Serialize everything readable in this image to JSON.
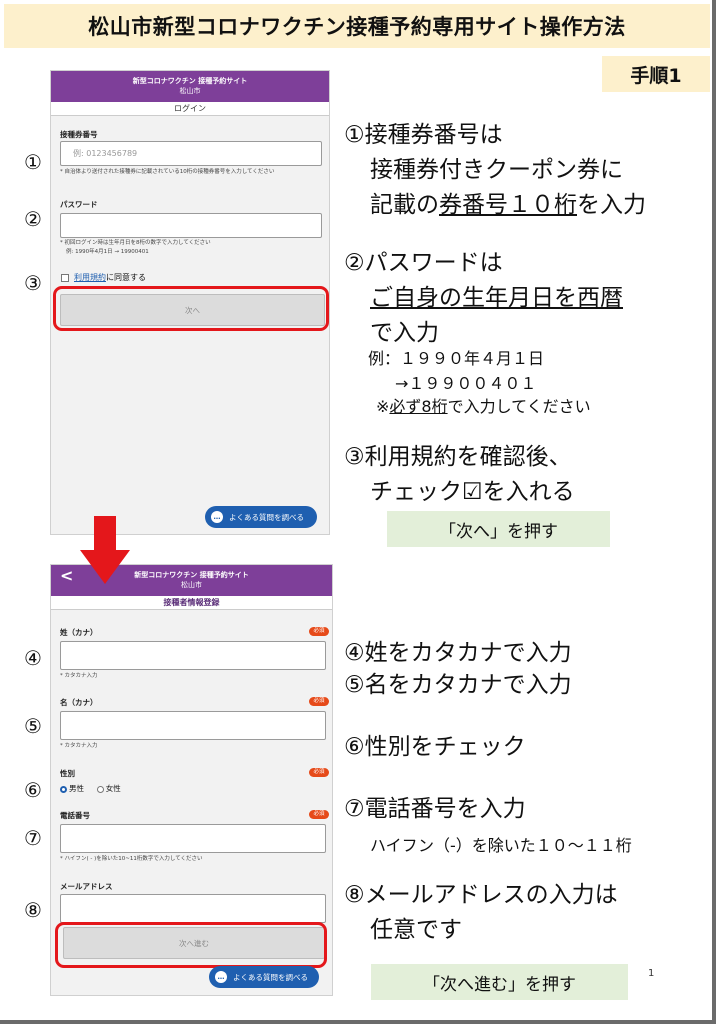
{
  "title": "松山市新型コロナワクチン接種予約専用サイト操作方法",
  "step": "手順1",
  "screen1": {
    "header_title": "新型コロナワクチン 接種予約サイト",
    "header_city": "松山市",
    "subheader": "ログイン",
    "ticket_label": "接種券番号",
    "ticket_placeholder": "例: 0123456789",
    "ticket_note": "* 自治体より送付された接種券に記載されている10桁の接種券番号を入力してください",
    "password_label": "パスワード",
    "password_note1": "* 初回ログイン時は生年月日を8桁の数字で入力してください",
    "password_note2": "例: 1990年4月1日 → 19900401",
    "terms_link": "利用規約",
    "terms_text": "に同意する",
    "next_button": "次へ",
    "faq_button": "よくある質問を調べる"
  },
  "screen2": {
    "header_title": "新型コロナワクチン 接種予約サイト",
    "header_city": "松山市",
    "back": "<",
    "subheader": "接種者情報登録",
    "required": "必須",
    "last_name_label": "姓（カナ）",
    "last_name_note": "* カタカナ入力",
    "first_name_label": "名（カナ）",
    "first_name_note": "* カタカナ入力",
    "gender_label": "性別",
    "gender_male": "男性",
    "gender_female": "女性",
    "phone_label": "電話番号",
    "phone_note": "* ハイフン( - )を除いた10~11桁数字で入力してください",
    "email_label": "メールアドレス",
    "next_button": "次へ進む",
    "faq_button": "よくある質問を調べる"
  },
  "markers": [
    "①",
    "②",
    "③",
    "④",
    "⑤",
    "⑥",
    "⑦",
    "⑧"
  ],
  "instructions": {
    "i1_a": "①接種券番号は",
    "i1_b": "接種券付きクーポン券に",
    "i1_c_pre": "記載の",
    "i1_c_u": "券番号１０桁",
    "i1_c_post": "を入力",
    "i2_a": "②パスワードは",
    "i2_b": "ご自身の生年月日を西暦",
    "i2_c": "で入力",
    "i2_ex1": "例：１９９０年４月１日",
    "i2_ex2": "→１９９００４０１",
    "i2_ex3_pre": "※",
    "i2_ex3_u": "必ず8桁",
    "i2_ex3_post": "で入力してください",
    "i3_a": "③利用規約を確認後、",
    "i3_b": "チェック☑を入れる",
    "pill1": "「次へ」を押す",
    "i4": "④姓をカタカナで入力",
    "i5": "⑤名をカタカナで入力",
    "i6": "⑥性別をチェック",
    "i7": "⑦電話番号を入力",
    "i7_note": "ハイフン（-）を除いた１０～１１桁",
    "i8_a": "⑧メールアドレスの入力は",
    "i8_b": "任意です",
    "pill2": "「次へ進む」を押す"
  },
  "page_number": "1",
  "colors": {
    "title_bg": "#fdf0cc",
    "header": "#7e3f99",
    "highlight": "#e4171b",
    "pill_bg": "#e3efd9",
    "faq": "#1f5fb0"
  }
}
